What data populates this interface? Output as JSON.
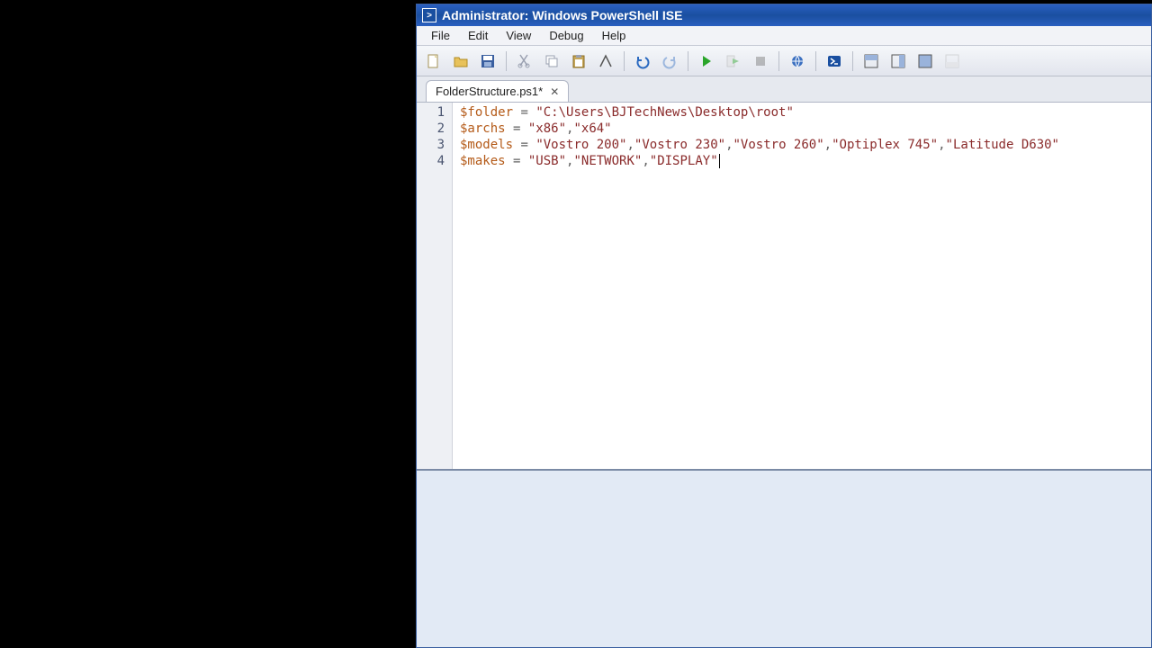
{
  "title": "Administrator: Windows PowerShell ISE",
  "menu": {
    "file": "File",
    "edit": "Edit",
    "view": "View",
    "debug": "Debug",
    "help": "Help"
  },
  "tab": {
    "label": "FolderStructure.ps1*"
  },
  "code": {
    "lines": [
      {
        "n": "1",
        "var": "$folder",
        "vals": [
          "\"C:\\Users\\BJTechNews\\Desktop\\root\""
        ]
      },
      {
        "n": "2",
        "var": "$archs",
        "vals": [
          "\"x86\"",
          "\"x64\""
        ]
      },
      {
        "n": "3",
        "var": "$models",
        "vals": [
          "\"Vostro 200\"",
          "\"Vostro 230\"",
          "\"Vostro 260\"",
          "\"Optiplex 745\"",
          "\"Latitude D630\""
        ]
      },
      {
        "n": "4",
        "var": "$makes",
        "vals": [
          "\"USB\"",
          "\"NETWORK\"",
          "\"DISPLAY\""
        ]
      }
    ]
  }
}
